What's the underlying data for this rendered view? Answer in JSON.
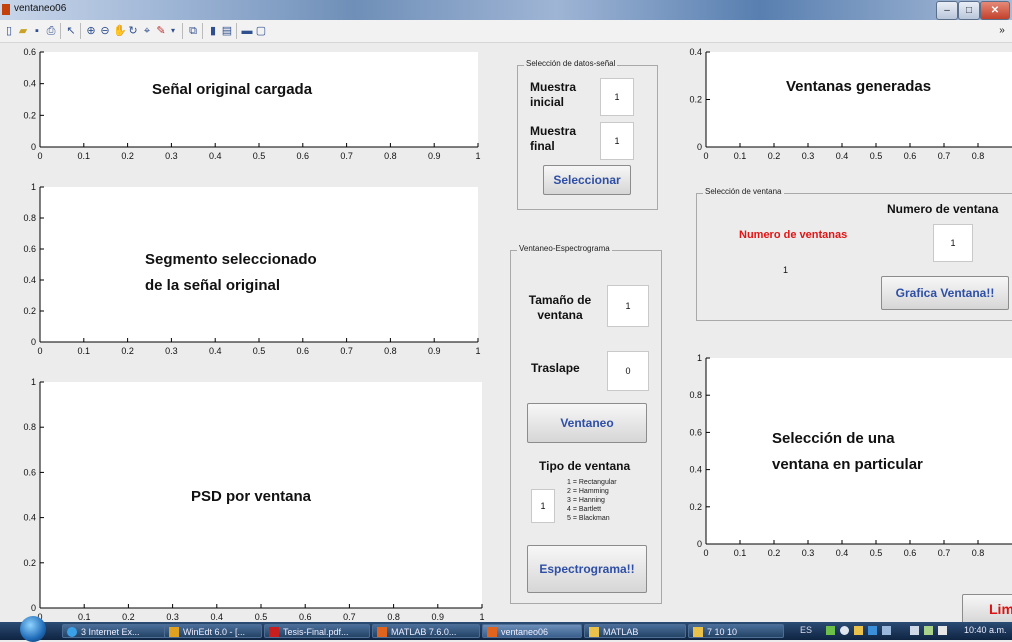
{
  "window": {
    "title": "ventaneo06",
    "min": "–",
    "max": "□",
    "close": "✕"
  },
  "toolbar": {
    "icons": [
      "new-icon",
      "open-icon",
      "save-icon",
      "print-icon",
      "pointer-icon",
      "zoom-in-icon",
      "zoom-out-icon",
      "pan-icon",
      "rotate-icon",
      "data-cursor-icon",
      "brush-icon",
      "link-icon",
      "colorbar-icon",
      "legend-icon",
      "plot-tools-icon",
      "dock-icon"
    ],
    "overflow": "»"
  },
  "axes": {
    "original": {
      "label": "Señal original cargada",
      "xticks": [
        "0",
        "0.1",
        "0.2",
        "0.3",
        "0.4",
        "0.5",
        "0.6",
        "0.7",
        "0.8",
        "0.9",
        "1"
      ],
      "yticks": [
        "0",
        "0.2",
        "0.4",
        "0.6"
      ]
    },
    "segment": {
      "label_line1": "Segmento seleccionado",
      "label_line2": "de la señal original",
      "xticks": [
        "0",
        "0.1",
        "0.2",
        "0.3",
        "0.4",
        "0.5",
        "0.6",
        "0.7",
        "0.8",
        "0.9",
        "1"
      ],
      "yticks": [
        "0",
        "0.2",
        "0.4",
        "0.6",
        "0.8",
        "1"
      ]
    },
    "psd": {
      "label": "PSD por ventana",
      "xticks": [
        "0",
        "0.1",
        "0.2",
        "0.3",
        "0.4",
        "0.5",
        "0.6",
        "0.7",
        "0.8",
        "0.9",
        "1"
      ],
      "yticks": [
        "0",
        "0.2",
        "0.4",
        "0.6",
        "0.8",
        "1"
      ]
    },
    "windows": {
      "label": "Ventanas generadas",
      "xticks": [
        "0",
        "0.1",
        "0.2",
        "0.3",
        "0.4",
        "0.5",
        "0.6",
        "0.7",
        "0.8"
      ],
      "yticks": [
        "0",
        "0.2",
        "0.4"
      ]
    },
    "selected": {
      "label_line1": "Selección de una",
      "label_line2": "ventana en particular",
      "xticks": [
        "0",
        "0.1",
        "0.2",
        "0.3",
        "0.4",
        "0.5",
        "0.6",
        "0.7",
        "0.8"
      ],
      "yticks": [
        "0",
        "0.2",
        "0.4",
        "0.6",
        "0.8",
        "1"
      ]
    }
  },
  "seleccion_datos": {
    "title": "Selección de datos-señal",
    "muestra_inicial_label": "Muestra inicial",
    "muestra_inicial_line1": "Muestra",
    "muestra_inicial_line2": "inicial",
    "muestra_inicial_value": "1",
    "muestra_final_line1": "Muestra",
    "muestra_final_line2": "final",
    "muestra_final_value": "1",
    "seleccionar_button": "Seleccionar"
  },
  "ventaneo": {
    "title": "Ventaneo-Espectrograma",
    "tamano_line1": "Tamaño de",
    "tamano_line2": "ventana",
    "tamano_value": "1",
    "traslape_label": "Traslape",
    "traslape_value": "0",
    "ventaneo_button": "Ventaneo",
    "tipo_label": "Tipo de ventana",
    "tipo_value": "1",
    "tipos": [
      "1 = Rectangular",
      "2 = Hamming",
      "3 = Hanning",
      "4 = Bartlett",
      "5 = Blackman"
    ],
    "espectrograma_button": "Espectrograma!!"
  },
  "seleccion_ventana": {
    "title": "Selección de ventana",
    "numero_ventana_label": "Numero de ventana",
    "numero_ventanas_label": "Numero de ventanas",
    "numero_ventanas_value": "1",
    "numero_ventana_value": "1",
    "grafica_button": "Grafica Ventana!!"
  },
  "limpiar_button": "Lim",
  "taskbar": {
    "items": [
      {
        "label": "3 Internet Ex...",
        "active": false
      },
      {
        "label": "WinEdt 6.0 - [...",
        "active": false
      },
      {
        "label": "Tesis-Final.pdf...",
        "active": false
      },
      {
        "label": "MATLAB 7.6.0...",
        "active": false
      },
      {
        "label": "ventaneo06",
        "active": true
      },
      {
        "label": "MATLAB",
        "active": false
      },
      {
        "label": "7 10 10",
        "active": false
      }
    ],
    "language": "ES",
    "clock": "10:40 a.m."
  },
  "colors": {
    "red_label": "#e21414",
    "button_text": "#2e4fa5"
  }
}
